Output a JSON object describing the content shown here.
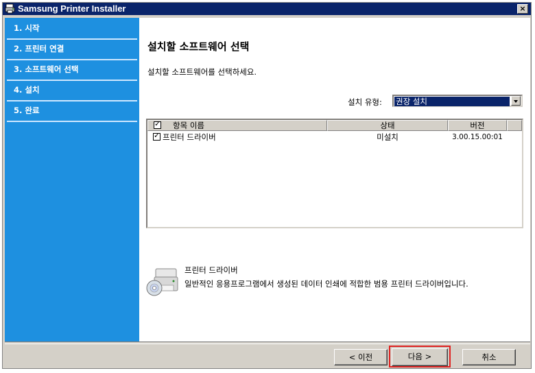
{
  "window": {
    "title": "Samsung Printer Installer",
    "close_glyph": "×"
  },
  "sidebar": {
    "items": [
      {
        "label": "1. 시작"
      },
      {
        "label": "2. 프린터 연결"
      },
      {
        "label": "3. 소프트웨어 선택"
      },
      {
        "label": "4. 설치"
      },
      {
        "label": "5. 완료"
      }
    ]
  },
  "main": {
    "heading": "설치할 소프트웨어 선택",
    "instruction": "설치할 소프트웨어를 선택하세요.",
    "install_type_label": "설치 유형:",
    "install_type_value": "권장 설치",
    "table": {
      "columns": [
        "항목 이름",
        "상태",
        "버전"
      ],
      "rows": [
        {
          "name": "프린터 드라이버",
          "status": "미설치",
          "version": "3.00.15.00:01"
        }
      ]
    },
    "info": {
      "title": "프린터 드라이버",
      "description": "일반적인 응용프로그램에서 생성된 데이터 인쇄에 적합한 범용 프린터 드라이버입니다."
    }
  },
  "buttons": {
    "back": "< 이전",
    "next": "다음 >",
    "cancel": "취소"
  },
  "colors": {
    "sidebar": "#1e90e0",
    "titlebar": "#0a246a",
    "highlight": "#e0201f"
  },
  "icons": {
    "app": "printer-installer-icon",
    "info": "printer-cd-icon"
  }
}
